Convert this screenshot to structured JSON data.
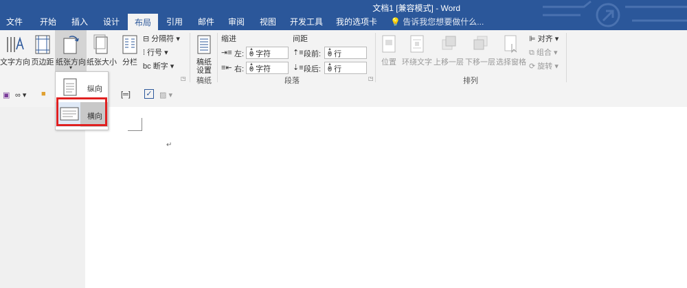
{
  "title": "文档1 [兼容模式] - Word",
  "tabs": [
    "文件",
    "开始",
    "插入",
    "设计",
    "布局",
    "引用",
    "邮件",
    "审阅",
    "视图",
    "开发工具",
    "我的选项卡"
  ],
  "active_tab": "布局",
  "tellme": "告诉我您想要做什么...",
  "page_setup": {
    "text_direction": "文字方向",
    "margins": "页边距",
    "orientation": "纸张方向",
    "size": "纸张大小",
    "columns": "分栏",
    "breaks": "分隔符",
    "line_numbers": "行号",
    "hyphenation": "断字"
  },
  "manuscript": {
    "button_line1": "稿纸",
    "button_line2": "设置",
    "group": "稿纸"
  },
  "paragraph": {
    "indent_label": "缩进",
    "spacing_label": "间距",
    "left_label": "左:",
    "right_label": "右:",
    "before_label": "段前:",
    "after_label": "段后:",
    "left_value": "0 字符",
    "right_value": "0 字符",
    "before_value": "0 行",
    "after_value": "0 行",
    "group": "段落"
  },
  "arrange": {
    "position": "位置",
    "wrap_text": "环绕文字",
    "bring_forward": "上移一层",
    "send_backward": "下移一层",
    "selection_pane": "选择窗格",
    "align": "对齐",
    "group_btn": "组合",
    "rotate": "旋转",
    "group": "排列"
  },
  "orientation_menu": {
    "portrait": "纵向",
    "landscape": "横向"
  }
}
